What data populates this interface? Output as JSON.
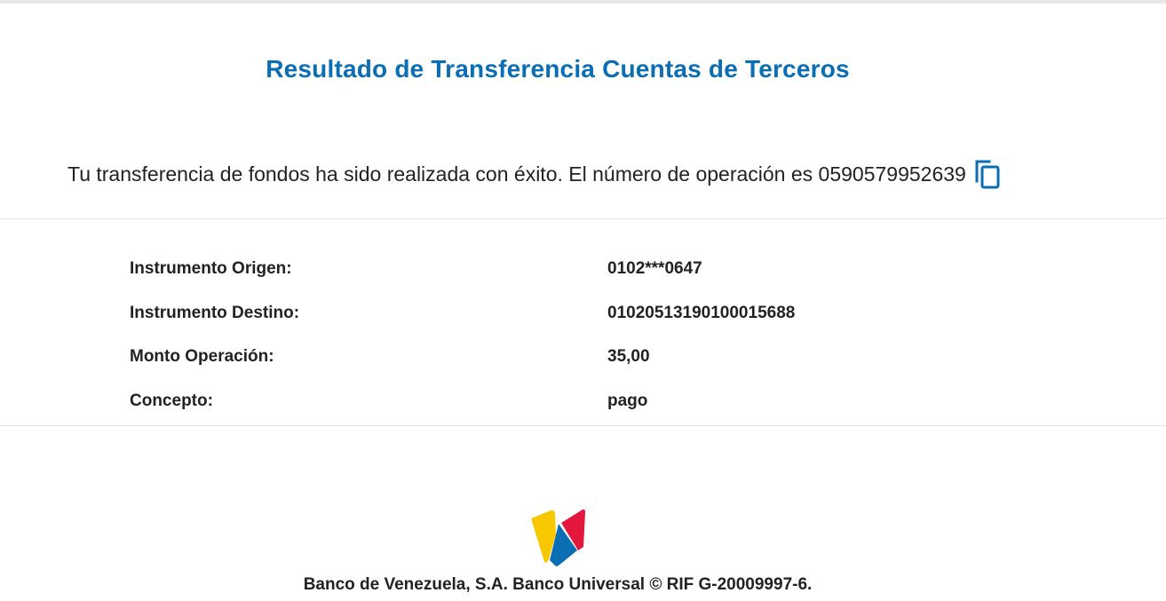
{
  "page": {
    "title": "Resultado de Transferencia Cuentas de Terceros"
  },
  "message": {
    "text": "Tu transferencia de fondos ha sido realizada con éxito. El número de operación es 0590579952639",
    "copy_icon": "copy-icon"
  },
  "details": [
    {
      "label": "Instrumento Origen:",
      "value": "0102***0647"
    },
    {
      "label": "Instrumento Destino:",
      "value": "01020513190100015688"
    },
    {
      "label": "Monto Operación:",
      "value": "35,00"
    },
    {
      "label": "Concepto:",
      "value": "pago"
    }
  ],
  "footer": {
    "text": "Banco de Venezuela, S.A. Banco Universal © RIF G-20009997-6."
  },
  "colors": {
    "accent": "#0a6eb4",
    "logo_yellow": "#f7c800",
    "logo_red": "#e3173e",
    "logo_blue": "#0a6eb4"
  }
}
